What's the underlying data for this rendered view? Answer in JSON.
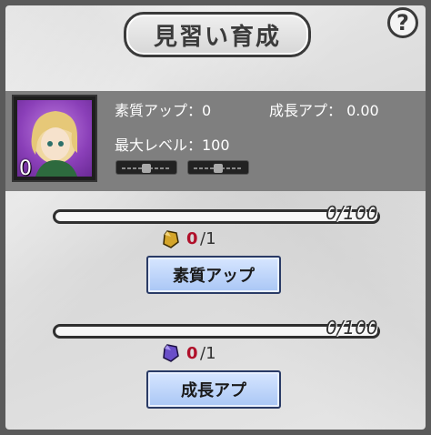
{
  "title": "見習い育成",
  "help_label": "?",
  "character": {
    "level": "0",
    "portrait_desc_icon": "character-portrait-icon"
  },
  "stats": {
    "aptitude_up": "素質アップ：0",
    "growth_up": "成長アプ：  0.00",
    "max_level": "最大レベル：100"
  },
  "sections": [
    {
      "progress_text": "0/100",
      "progress": 0,
      "cost_current": "0",
      "cost_max": "/1",
      "button_label": "素質アップ",
      "item_icon": "gold-crystal-icon"
    },
    {
      "progress_text": "0/100",
      "progress": 0,
      "cost_current": "0",
      "cost_max": "/1",
      "button_label": "成長アプ",
      "item_icon": "purple-crystal-icon"
    }
  ],
  "colors": {
    "accent_purple": "#8a3fb8",
    "cost_red": "#b0102a",
    "button_blue": "#a9c6f5"
  }
}
